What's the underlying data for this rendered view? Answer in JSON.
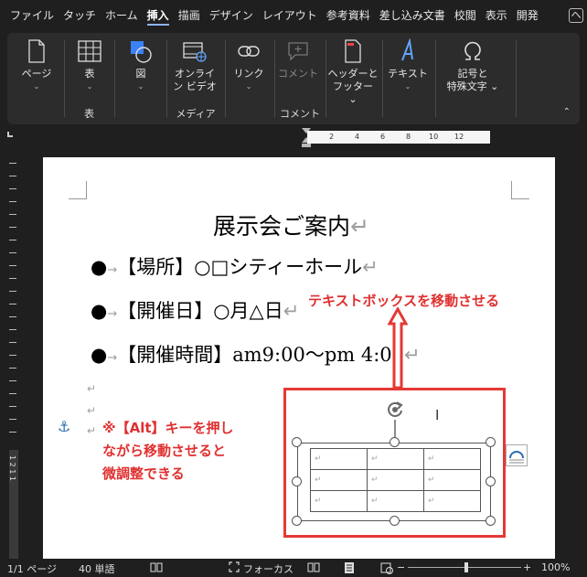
{
  "tabs": [
    "ファイル",
    "タッチ",
    "ホーム",
    "挿入",
    "描画",
    "デザイン",
    "レイアウト",
    "参考資料",
    "差し込み文書",
    "校閲",
    "表示",
    "開発"
  ],
  "active_tab": "挿入",
  "tab_overflow": "ヘ",
  "ribbon": {
    "page_btn": "ページ",
    "table_btn": "表",
    "table_group": "表",
    "figure_btn": "図",
    "online_video_line1": "オンライ",
    "online_video_line2": "ン ビデオ",
    "media_group": "メディア",
    "link_btn": "リンク",
    "comment_btn": "コメント",
    "comment_group": "コメント",
    "header_footer_line1": "ヘッダーと",
    "header_footer_line2": "フッター",
    "text_btn": "テキスト",
    "symbol_line1": "記号と",
    "symbol_line2": "特殊文字"
  },
  "ruler_ticks": [
    "2",
    "4",
    "6",
    "8",
    "10",
    "12"
  ],
  "vruler_label": "1 2 1 1",
  "document": {
    "title": "展示会ご案内",
    "items": [
      {
        "bullet": "●",
        "text": "【場所】○□シティーホール"
      },
      {
        "bullet": "●",
        "text": "【開催日】○月△日"
      },
      {
        "bullet": "●",
        "text": "【開催時間】am9:00～pm 4:00"
      }
    ],
    "para_mark": "↵",
    "tab_mark": "→"
  },
  "annotations": {
    "move_textbox": "テキストボックスを移動させる",
    "alt_line1": "※【Alt】キーを押し",
    "alt_line2": "ながら移動させると",
    "alt_line3": "微調整できる"
  },
  "table_cell_mark": "↵",
  "status": {
    "page": "1/1 ページ",
    "words": "40 単語",
    "focus": "フォーカス",
    "zoom": "100%",
    "minus": "−",
    "plus": "+"
  },
  "colors": {
    "annotation_red": "#e03030",
    "box_red": "#e53935",
    "accent_blue": "#8ab4f8"
  }
}
